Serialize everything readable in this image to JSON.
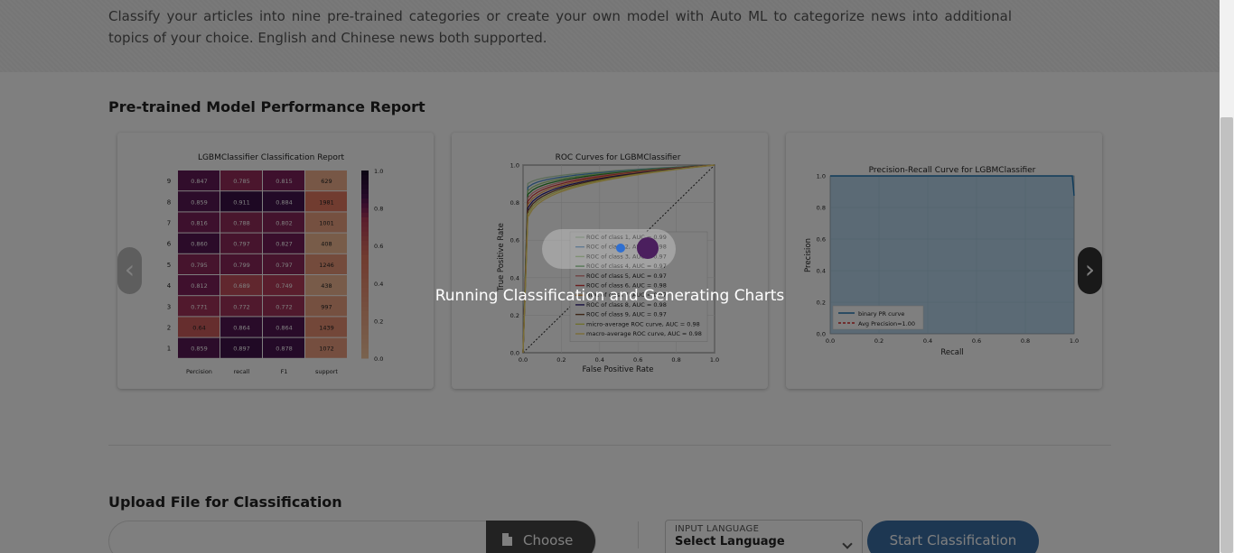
{
  "intro": {
    "text": "Classify your articles into nine pre-trained categories or create your own model with Auto ML to categorize news into additional topics of your choice. English and Chinese news both supported."
  },
  "performance": {
    "title": "Pre-trained Model Performance Report",
    "prev_icon": "chevron-left-icon",
    "prev_glyph": "‹",
    "next_icon": "chevron-right-icon",
    "next_glyph": "›"
  },
  "report": {
    "title": "LGBMClassifier Classification Report",
    "rows": [
      {
        "label": "9",
        "precision": "0.847",
        "recall": "0.785",
        "f1": "0.815",
        "support": "629"
      },
      {
        "label": "8",
        "precision": "0.859",
        "recall": "0.911",
        "f1": "0.884",
        "support": "1981"
      },
      {
        "label": "7",
        "precision": "0.816",
        "recall": "0.788",
        "f1": "0.802",
        "support": "1001"
      },
      {
        "label": "6",
        "precision": "0.860",
        "recall": "0.797",
        "f1": "0.827",
        "support": "408"
      },
      {
        "label": "5",
        "precision": "0.795",
        "recall": "0.799",
        "f1": "0.797",
        "support": "1246"
      },
      {
        "label": "4",
        "precision": "0.812",
        "recall": "0.689",
        "f1": "0.749",
        "support": "438"
      },
      {
        "label": "3",
        "precision": "0.771",
        "recall": "0.772",
        "f1": "0.772",
        "support": "997"
      },
      {
        "label": "2",
        "precision": "0.64",
        "recall": "0.864",
        "f1": "0.864",
        "support": "1439"
      },
      {
        "label": "1",
        "precision": "0.859",
        "recall": "0.897",
        "f1": "0.878",
        "support": "1072"
      }
    ],
    "columns": [
      "Percision",
      "recall",
      "F1",
      "support"
    ],
    "colorbar_ticks": [
      "1.0",
      "0.8",
      "0.6",
      "0.4",
      "0.2",
      "0.0"
    ]
  },
  "roc": {
    "title": "ROC Curves for LGBMClassifier",
    "xlabel": "False Positive Rate",
    "ylabel": "True Positive Rate",
    "ticks": [
      "0.0",
      "0.2",
      "0.4",
      "0.6",
      "0.8",
      "1.0"
    ],
    "legend": [
      {
        "label": "ROC of class 1, AUC = 0.99",
        "color": "#b7d9b1"
      },
      {
        "label": "ROC of class 2, AUC = 0.98",
        "color": "#4a8fcf"
      },
      {
        "label": "ROC of class 3, AUC = 0.97",
        "color": "#9dd17a"
      },
      {
        "label": "ROC of class 4, AUC = 0.97",
        "color": "#2a8a2a"
      },
      {
        "label": "ROC of class 5, AUC = 0.97",
        "color": "#e38a8a"
      },
      {
        "label": "ROC of class 6, AUC = 0.98",
        "color": "#d63a3a"
      },
      {
        "label": "ROC of class 7, AUC = 0.97",
        "color": "#f0a050"
      },
      {
        "label": "ROC of class 8, AUC = 0.98",
        "color": "#2e2080"
      },
      {
        "label": "ROC of class 9, AUC = 0.97",
        "color": "#7a4a2a"
      },
      {
        "label": "micro-average ROC curve, AUC = 0.98",
        "color": "#e0e060"
      },
      {
        "label": "macro-average ROC curve, AUC = 0.98",
        "color": "#f5d86a"
      }
    ]
  },
  "pr": {
    "title": "Precision-Recall Curve for LGBMClassifier",
    "xlabel": "Recall",
    "ylabel": "Precision",
    "ticks": [
      "0.0",
      "0.2",
      "0.4",
      "0.6",
      "0.8",
      "1.0"
    ],
    "legend": [
      "binary PR curve",
      "Avg Precision=1.00"
    ],
    "fill_color": "#b6d5ea",
    "line_color": "#1f77b4"
  },
  "upload": {
    "title": "Upload File for Classification",
    "choose_label": "Choose",
    "file_icon": "file-icon",
    "language_label": "INPUT LANGUAGE",
    "language_value": "Select Language",
    "chevron_icon": "chevron-down-icon",
    "start_label": "Start Classification"
  },
  "loading": {
    "text": "Running Classification and Generating Charts"
  },
  "colors": {
    "accent": "#3a6ea5",
    "overlay": "rgba(0,0,0,0.5)"
  }
}
